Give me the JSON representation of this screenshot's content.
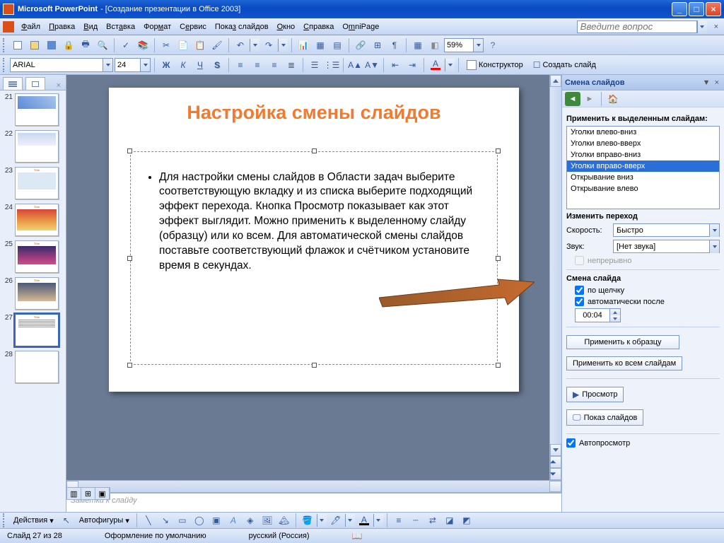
{
  "window": {
    "app_name": "Microsoft PowerPoint",
    "doc_title": "- [Создание презентации в Office 2003]"
  },
  "menu": {
    "items": [
      "Файл",
      "Правка",
      "Вид",
      "Вставка",
      "Формат",
      "Сервис",
      "Показ слайдов",
      "Окно",
      "Справка",
      "OmniPage"
    ],
    "question_placeholder": "Введите вопрос"
  },
  "toolbar": {
    "zoom": "59%",
    "font": "ARIAL",
    "font_size": "24",
    "designer_label": "Конструктор",
    "new_slide_label": "Создать слайд"
  },
  "thumbnails": {
    "start_index": 21,
    "selected": 27,
    "count": 8
  },
  "slide": {
    "title": "Настройка смены слайдов",
    "body": "Для настройки смены слайдов в Области задач выберите соответствующую вкладку и из списка выберите подходящий эффект перехода. Кнопка Просмотр показывает как этот эффект выглядит. Можно применить к выделенному слайду (образцу) или ко всем. Для автоматической смены слайдов поставьте соответствующий флажок и счётчиком установите время в секундах."
  },
  "notes": {
    "placeholder": "Заметки к слайду"
  },
  "task_pane": {
    "title": "Смена слайдов",
    "apply_label": "Применить к выделенным слайдам:",
    "transitions": [
      "Уголки влево-вниз",
      "Уголки влево-вверх",
      "Уголки вправо-вниз",
      "Уголки вправо-вверх",
      "Открывание вниз",
      "Открывание влево"
    ],
    "selected_transition": 3,
    "modify_label": "Изменить переход",
    "speed_label": "Скорость:",
    "speed_value": "Быстро",
    "sound_label": "Звук:",
    "sound_value": "[Нет звука]",
    "loop_label": "непрерывно",
    "advance_label": "Смена слайда",
    "on_click_label": "по щелчку",
    "auto_after_label": "автоматически после",
    "auto_time": "00:04",
    "apply_master": "Применить к образцу",
    "apply_all": "Применить ко всем слайдам",
    "play": "Просмотр",
    "slideshow": "Показ слайдов",
    "autopreview": "Автопросмотр"
  },
  "drawbar": {
    "actions": "Действия",
    "autoshapes": "Автофигуры"
  },
  "status": {
    "slide": "Слайд 27 из 28",
    "design": "Оформление по умолчанию",
    "lang": "русский (Россия)"
  }
}
